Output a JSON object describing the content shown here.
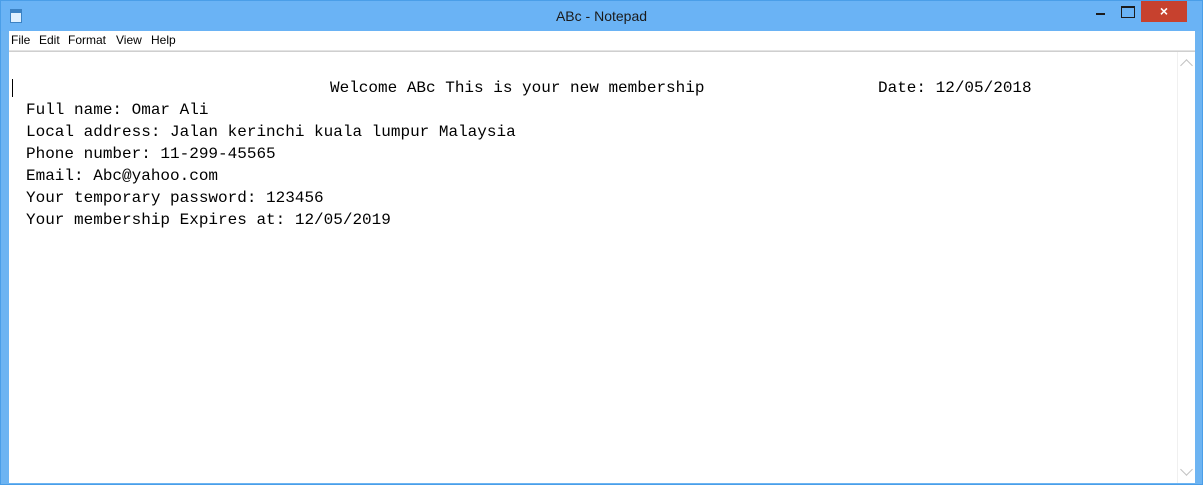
{
  "window": {
    "title": "ABc - Notepad",
    "close_glyph": "×"
  },
  "menu": [
    "File",
    "Edit",
    "Format",
    "View",
    "Help"
  ],
  "document": {
    "header": "Welcome ABc This is your new membership",
    "date": "Date: 12/05/2018",
    "lines": [
      "Full name: Omar Ali",
      "Local address: Jalan kerinchi kuala lumpur Malaysia",
      "Phone number: 11-299-45565",
      "Email: Abc@yahoo.com",
      "Your temporary password: 123456",
      "Your membership Expires at: 12/05/2019"
    ]
  },
  "icons": [
    "notepad-app-icon",
    "minimize-icon",
    "maximize-icon",
    "close-icon",
    "scroll-up-icon",
    "scroll-down-icon"
  ],
  "colors": {
    "titlebar": "#6ab3f5",
    "close_button": "#c7412e"
  }
}
